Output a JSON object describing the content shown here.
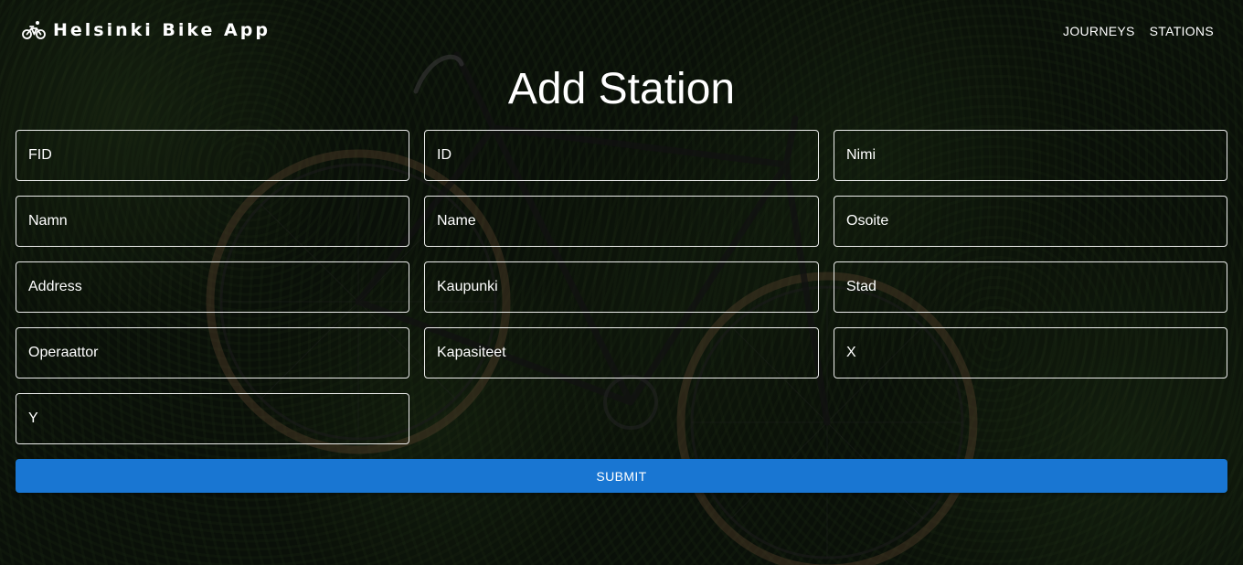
{
  "header": {
    "brand_name": "Helsinki Bike App",
    "brand_icon": "bicycle-icon",
    "nav": [
      {
        "label": "JOURNEYS"
      },
      {
        "label": "STATIONS"
      }
    ]
  },
  "page": {
    "title": "Add Station"
  },
  "form": {
    "fields": [
      {
        "placeholder": "FID",
        "value": ""
      },
      {
        "placeholder": "ID",
        "value": ""
      },
      {
        "placeholder": "Nimi",
        "value": ""
      },
      {
        "placeholder": "Namn",
        "value": ""
      },
      {
        "placeholder": "Name",
        "value": ""
      },
      {
        "placeholder": "Osoite",
        "value": ""
      },
      {
        "placeholder": "Address",
        "value": ""
      },
      {
        "placeholder": "Kaupunki",
        "value": ""
      },
      {
        "placeholder": "Stad",
        "value": ""
      },
      {
        "placeholder": "Operaattor",
        "value": ""
      },
      {
        "placeholder": "Kapasiteet",
        "value": ""
      },
      {
        "placeholder": "X",
        "value": ""
      },
      {
        "placeholder": "Y",
        "value": ""
      }
    ],
    "submit_label": "SUBMIT"
  },
  "colors": {
    "accent": "#1976d2",
    "text": "#ffffff",
    "field_border": "#ffffff"
  }
}
